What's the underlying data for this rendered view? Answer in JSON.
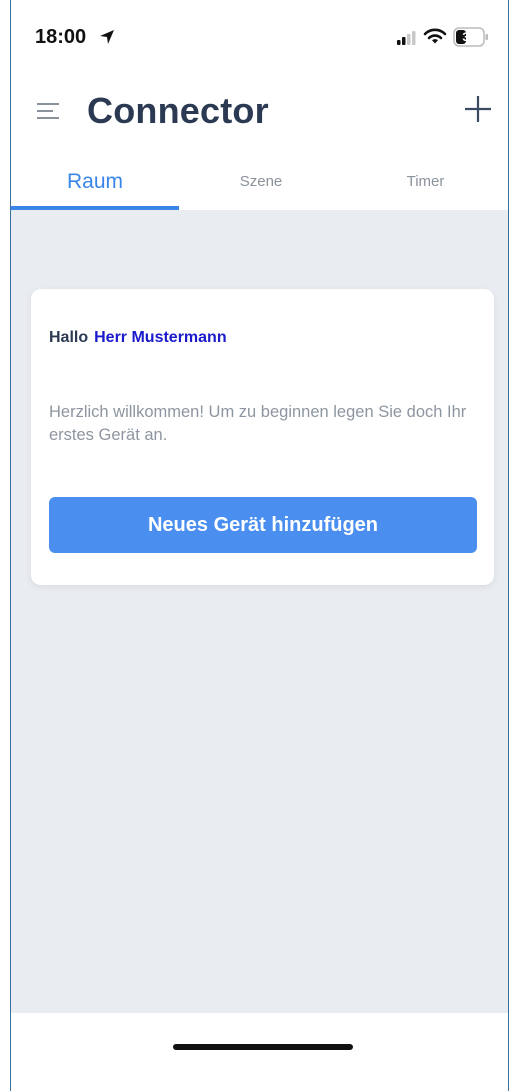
{
  "status_bar": {
    "time": "18:00",
    "battery_level": "31",
    "icons": [
      "location-arrow-icon",
      "signal-icon",
      "wifi-icon",
      "battery-icon"
    ]
  },
  "header": {
    "title": "Connector",
    "icons": [
      "hamburger-menu-icon",
      "plus-icon"
    ]
  },
  "tabs": [
    {
      "label": "Raum",
      "active": true
    },
    {
      "label": "Szene",
      "active": false
    },
    {
      "label": "Timer",
      "active": false
    }
  ],
  "card": {
    "greeting": "Hallo",
    "user_name": "Herr Mustermann",
    "welcome_text": "Herzlich willkommen! Um zu beginnen legen Sie doch Ihr erstes Gerät an.",
    "button_label": "Neues Gerät hinzufügen"
  },
  "colors": {
    "accent": "#3a86e8",
    "button": "#4a8ff0",
    "title": "#2b3a52",
    "name_highlight": "#1a1acc",
    "background": "#e9edf1"
  }
}
